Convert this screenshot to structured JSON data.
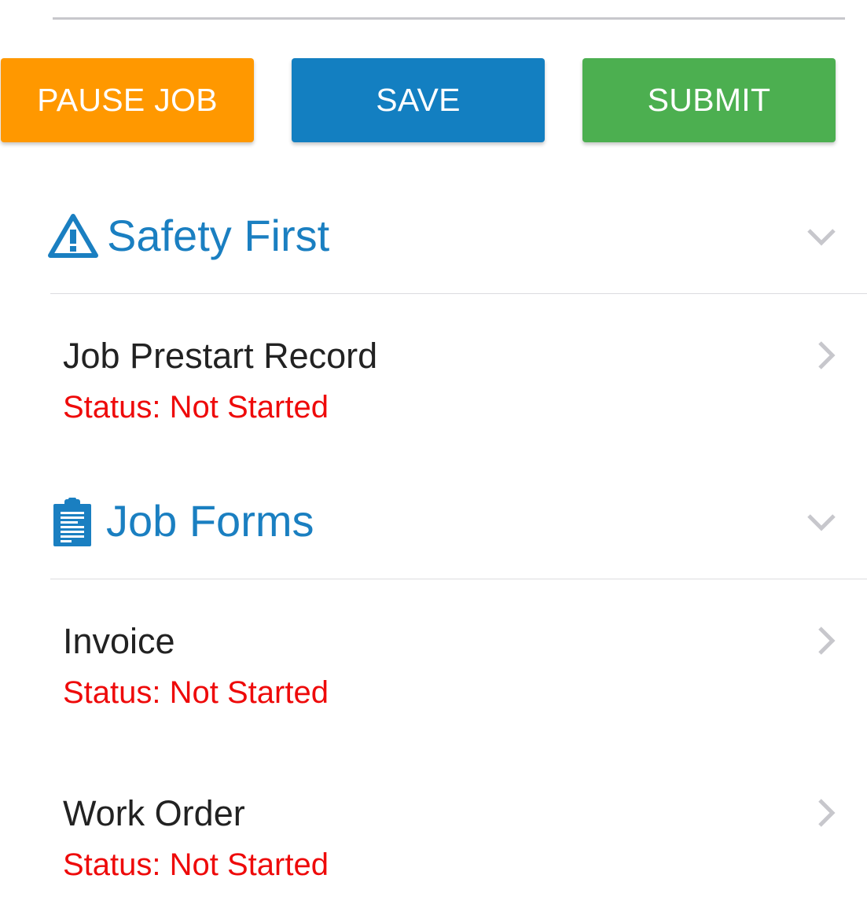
{
  "toolbar": {
    "pause_label": "PAUSE JOB",
    "save_label": "SAVE",
    "submit_label": "SUBMIT",
    "colors": {
      "pause": "#ff9800",
      "save": "#137fc1",
      "submit": "#4caf50"
    }
  },
  "sections": [
    {
      "title": "Safety First",
      "icon": "warning-triangle-icon",
      "expanded": true,
      "items": [
        {
          "title": "Job Prestart Record",
          "status": "Status: Not Started"
        }
      ]
    },
    {
      "title": "Job Forms",
      "icon": "clipboard-icon",
      "expanded": true,
      "items": [
        {
          "title": "Invoice",
          "status": "Status: Not Started"
        },
        {
          "title": "Work Order",
          "status": "Status: Not Started"
        }
      ]
    }
  ],
  "colors": {
    "section_title": "#1a7fc1",
    "status_text": "#ee0a0a",
    "chevron": "#c7c7cc"
  }
}
